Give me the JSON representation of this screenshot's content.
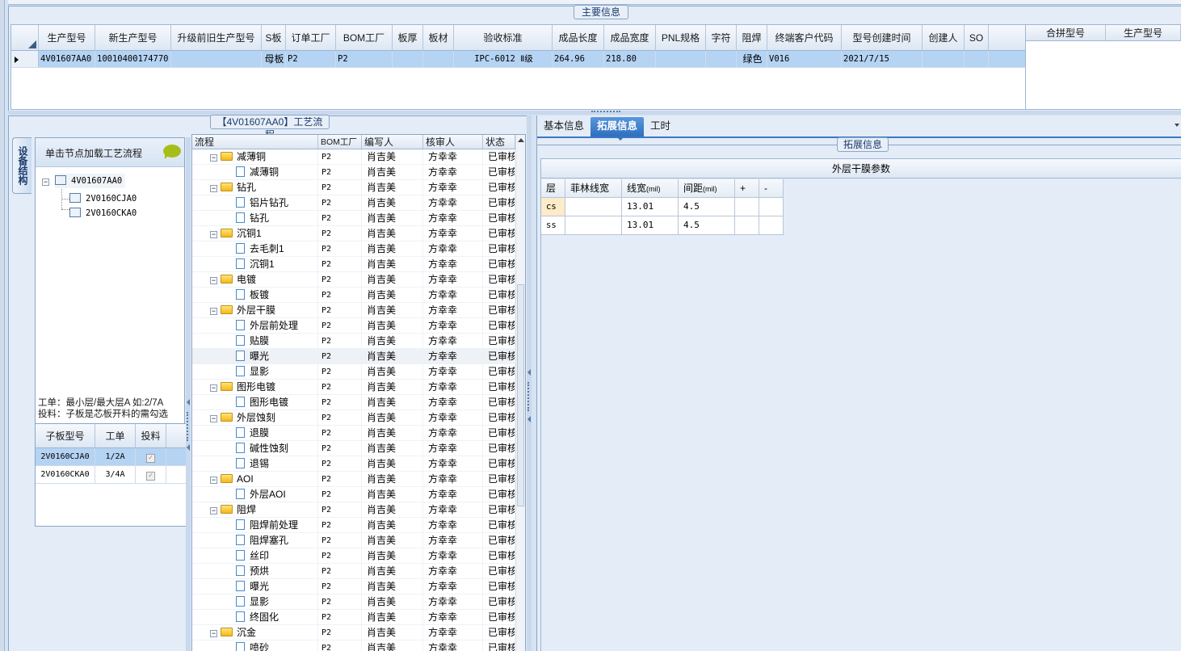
{
  "main": {
    "caption": "主要信息",
    "columns": [
      "生产型号",
      "新生产型号",
      "升级前旧生产型号",
      "S板",
      "订单工厂",
      "BOM工厂",
      "板厚",
      "板材",
      "验收标准",
      "成品长度",
      "成品宽度",
      "PNL规格",
      "字符",
      "阻焊",
      "终端客户代码",
      "型号创建时间",
      "创建人",
      "SO"
    ],
    "row": [
      "4V01607AA0",
      "10010400174770",
      "",
      "母板",
      "P2",
      "P2",
      "",
      "",
      "IPC-6012 Ⅱ级",
      "264.96",
      "218.80",
      "",
      "",
      "绿色",
      "V016",
      "2021/7/15",
      "",
      ""
    ],
    "merge_columns": [
      "合拼型号",
      "生产型号"
    ]
  },
  "flow_panel": {
    "caption": "【4V01607AA0】工艺流程",
    "vertical_tab": "设备结构",
    "tree_title": "单击节点加载工艺流程",
    "tree_nodes": [
      "4V01607AA0",
      "2V0160CJA0",
      "2V0160CKA0"
    ],
    "hint_line1": "工单：最小层/最大层A 如:2/7A",
    "hint_line2": "投料：子板是芯板开料的需勾选",
    "sub_columns": [
      "子板型号",
      "工单",
      "投料"
    ],
    "sub_rows": [
      {
        "model": "2V0160CJA0",
        "order": "1/2A",
        "check": "✓"
      },
      {
        "model": "2V0160CKA0",
        "order": "3/4A",
        "check": "✓"
      }
    ]
  },
  "flow_grid": {
    "columns": [
      "流程",
      "BOM工厂",
      "编写人",
      "核审人",
      "状态"
    ],
    "rows": [
      {
        "name": "减薄铜",
        "type": "folder",
        "bom": "P2",
        "writer": "肖吉美",
        "reviewer": "方幸幸",
        "status": "已审核"
      },
      {
        "name": "减薄铜",
        "type": "doc",
        "bom": "P2",
        "writer": "肖吉美",
        "reviewer": "方幸幸",
        "status": "已审核"
      },
      {
        "name": "钻孔",
        "type": "folder",
        "bom": "P2",
        "writer": "肖吉美",
        "reviewer": "方幸幸",
        "status": "已审核"
      },
      {
        "name": "铝片钻孔",
        "type": "doc",
        "bom": "P2",
        "writer": "肖吉美",
        "reviewer": "方幸幸",
        "status": "已审核"
      },
      {
        "name": "钻孔",
        "type": "doc",
        "bom": "P2",
        "writer": "肖吉美",
        "reviewer": "方幸幸",
        "status": "已审核"
      },
      {
        "name": "沉铜1",
        "type": "folder",
        "bom": "P2",
        "writer": "肖吉美",
        "reviewer": "方幸幸",
        "status": "已审核"
      },
      {
        "name": "去毛刺1",
        "type": "doc",
        "bom": "P2",
        "writer": "肖吉美",
        "reviewer": "方幸幸",
        "status": "已审核"
      },
      {
        "name": "沉铜1",
        "type": "doc",
        "bom": "P2",
        "writer": "肖吉美",
        "reviewer": "方幸幸",
        "status": "已审核"
      },
      {
        "name": "电镀",
        "type": "folder",
        "bom": "P2",
        "writer": "肖吉美",
        "reviewer": "方幸幸",
        "status": "已审核"
      },
      {
        "name": "板镀",
        "type": "doc",
        "bom": "P2",
        "writer": "肖吉美",
        "reviewer": "方幸幸",
        "status": "已审核"
      },
      {
        "name": "外层干膜",
        "type": "folder",
        "bom": "P2",
        "writer": "肖吉美",
        "reviewer": "方幸幸",
        "status": "已审核"
      },
      {
        "name": "外层前处理",
        "type": "doc",
        "bom": "P2",
        "writer": "肖吉美",
        "reviewer": "方幸幸",
        "status": "已审核"
      },
      {
        "name": "贴膜",
        "type": "doc",
        "bom": "P2",
        "writer": "肖吉美",
        "reviewer": "方幸幸",
        "status": "已审核"
      },
      {
        "name": "曝光",
        "type": "doc",
        "bom": "P2",
        "writer": "肖吉美",
        "reviewer": "方幸幸",
        "status": "已审核",
        "selected": true
      },
      {
        "name": "显影",
        "type": "doc",
        "bom": "P2",
        "writer": "肖吉美",
        "reviewer": "方幸幸",
        "status": "已审核"
      },
      {
        "name": "图形电镀",
        "type": "folder",
        "bom": "P2",
        "writer": "肖吉美",
        "reviewer": "方幸幸",
        "status": "已审核"
      },
      {
        "name": "图形电镀",
        "type": "doc",
        "bom": "P2",
        "writer": "肖吉美",
        "reviewer": "方幸幸",
        "status": "已审核"
      },
      {
        "name": "外层蚀刻",
        "type": "folder",
        "bom": "P2",
        "writer": "肖吉美",
        "reviewer": "方幸幸",
        "status": "已审核"
      },
      {
        "name": "退膜",
        "type": "doc",
        "bom": "P2",
        "writer": "肖吉美",
        "reviewer": "方幸幸",
        "status": "已审核"
      },
      {
        "name": "碱性蚀刻",
        "type": "doc",
        "bom": "P2",
        "writer": "肖吉美",
        "reviewer": "方幸幸",
        "status": "已审核"
      },
      {
        "name": "退锡",
        "type": "doc",
        "bom": "P2",
        "writer": "肖吉美",
        "reviewer": "方幸幸",
        "status": "已审核"
      },
      {
        "name": "AOI",
        "type": "folder",
        "bom": "P2",
        "writer": "肖吉美",
        "reviewer": "方幸幸",
        "status": "已审核"
      },
      {
        "name": "外层AOI",
        "type": "doc",
        "bom": "P2",
        "writer": "肖吉美",
        "reviewer": "方幸幸",
        "status": "已审核"
      },
      {
        "name": "阻焊",
        "type": "folder",
        "bom": "P2",
        "writer": "肖吉美",
        "reviewer": "方幸幸",
        "status": "已审核"
      },
      {
        "name": "阻焊前处理",
        "type": "doc",
        "bom": "P2",
        "writer": "肖吉美",
        "reviewer": "方幸幸",
        "status": "已审核"
      },
      {
        "name": "阻焊塞孔",
        "type": "doc",
        "bom": "P2",
        "writer": "肖吉美",
        "reviewer": "方幸幸",
        "status": "已审核"
      },
      {
        "name": "丝印",
        "type": "doc",
        "bom": "P2",
        "writer": "肖吉美",
        "reviewer": "方幸幸",
        "status": "已审核"
      },
      {
        "name": "预烘",
        "type": "doc",
        "bom": "P2",
        "writer": "肖吉美",
        "reviewer": "方幸幸",
        "status": "已审核"
      },
      {
        "name": "曝光",
        "type": "doc",
        "bom": "P2",
        "writer": "肖吉美",
        "reviewer": "方幸幸",
        "status": "已审核"
      },
      {
        "name": "显影",
        "type": "doc",
        "bom": "P2",
        "writer": "肖吉美",
        "reviewer": "方幸幸",
        "status": "已审核"
      },
      {
        "name": "终固化",
        "type": "doc",
        "bom": "P2",
        "writer": "肖吉美",
        "reviewer": "方幸幸",
        "status": "已审核"
      },
      {
        "name": "沉金",
        "type": "folder",
        "bom": "P2",
        "writer": "肖吉美",
        "reviewer": "方幸幸",
        "status": "已审核"
      },
      {
        "name": "喷砂",
        "type": "doc",
        "bom": "P2",
        "writer": "肖吉美",
        "reviewer": "方幸幸",
        "status": "已审核"
      }
    ]
  },
  "right": {
    "tabs": [
      "基本信息",
      "拓展信息",
      "工时"
    ],
    "active_tab": 1,
    "ext_caption": "拓展信息",
    "param_title": "外层干膜参数",
    "param_columns": [
      "层",
      "菲林线宽",
      "线宽",
      "间距",
      "+",
      "-"
    ],
    "param_units": [
      "",
      "",
      "(mil)",
      "(mil)",
      "",
      ""
    ],
    "param_rows": [
      {
        "layer": "cs",
        "film": "",
        "width": "13.01",
        "spacing": "4.5"
      },
      {
        "layer": "ss",
        "film": "",
        "width": "13.01",
        "spacing": "4.5"
      }
    ]
  }
}
